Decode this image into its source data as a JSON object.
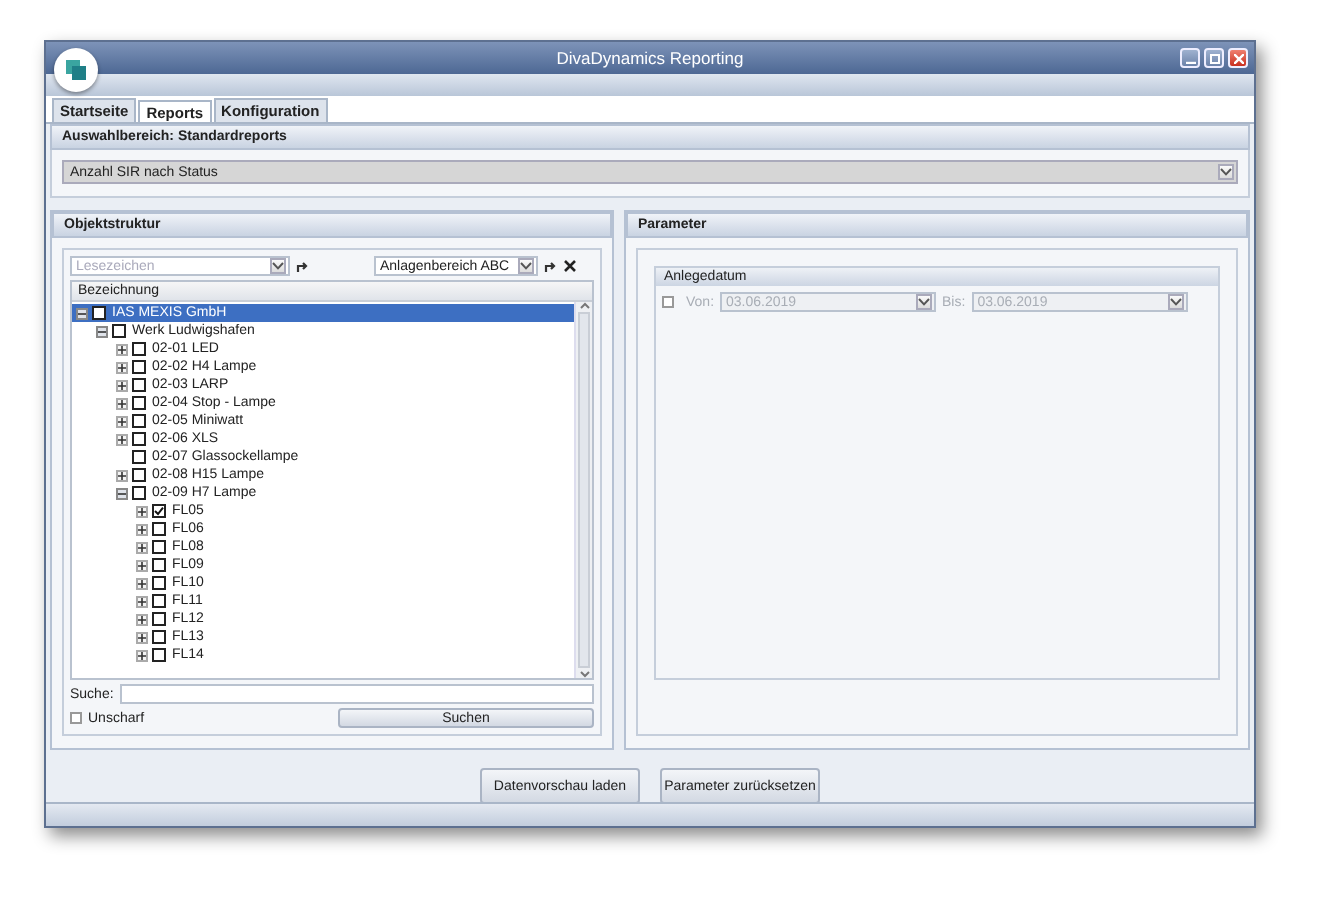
{
  "window": {
    "title": "DivaDynamics Reporting"
  },
  "tabs": [
    {
      "label": "Startseite",
      "selected": false
    },
    {
      "label": "Reports",
      "selected": true
    },
    {
      "label": "Konfiguration",
      "selected": false
    }
  ],
  "selection_area": {
    "title": "Auswahlbereich: Standardreports",
    "report": "Anzahl SIR nach Status"
  },
  "object_structure": {
    "title": "Objektstruktur",
    "bookmark_field": {
      "placeholder": "Lesezeichen"
    },
    "area_field": {
      "value": "Anlagenbereich ABC"
    },
    "tree": {
      "column": "Bezeichnung",
      "nodes": [
        {
          "label": "IAS MEXIS GmbH",
          "kind": "expanded",
          "checked": false,
          "selected": true,
          "children": [
            {
              "label": "Werk Ludwigshafen",
              "kind": "expanded",
              "checked": false,
              "selected": false,
              "children": [
                {
                  "label": "02-01 LED",
                  "kind": "collapsed",
                  "checked": false,
                  "selected": false
                },
                {
                  "label": "02-02 H4 Lampe",
                  "kind": "collapsed",
                  "checked": false,
                  "selected": false
                },
                {
                  "label": "02-03 LARP",
                  "kind": "collapsed",
                  "checked": false,
                  "selected": false
                },
                {
                  "label": "02-04 Stop - Lampe",
                  "kind": "collapsed",
                  "checked": false,
                  "selected": false
                },
                {
                  "label": "02-05 Miniwatt",
                  "kind": "collapsed",
                  "checked": false,
                  "selected": false
                },
                {
                  "label": "02-06 XLS",
                  "kind": "collapsed",
                  "checked": false,
                  "selected": false
                },
                {
                  "label": "02-07 Glassockellampe",
                  "kind": "leaf",
                  "checked": false,
                  "selected": false
                },
                {
                  "label": "02-08 H15 Lampe",
                  "kind": "collapsed",
                  "checked": false,
                  "selected": false
                },
                {
                  "label": "02-09 H7 Lampe",
                  "kind": "expanded",
                  "checked": false,
                  "selected": false,
                  "children": [
                    {
                      "label": "FL05",
                      "kind": "collapsed",
                      "checked": true,
                      "selected": false
                    },
                    {
                      "label": "FL06",
                      "kind": "collapsed",
                      "checked": false,
                      "selected": false
                    },
                    {
                      "label": "FL08",
                      "kind": "collapsed",
                      "checked": false,
                      "selected": false
                    },
                    {
                      "label": "FL09",
                      "kind": "collapsed",
                      "checked": false,
                      "selected": false
                    },
                    {
                      "label": "FL10",
                      "kind": "collapsed",
                      "checked": false,
                      "selected": false
                    },
                    {
                      "label": "FL11",
                      "kind": "collapsed",
                      "checked": false,
                      "selected": false
                    },
                    {
                      "label": "FL12",
                      "kind": "collapsed",
                      "checked": false,
                      "selected": false
                    },
                    {
                      "label": "FL13",
                      "kind": "collapsed",
                      "checked": false,
                      "selected": false
                    },
                    {
                      "label": "FL14",
                      "kind": "collapsed",
                      "checked": false,
                      "selected": false
                    }
                  ]
                }
              ]
            }
          ]
        }
      ]
    },
    "search": {
      "label": "Suche:",
      "fuzzy": {
        "label": "Unscharf",
        "checked": false
      },
      "button": "Suchen"
    }
  },
  "parameters": {
    "title": "Parameter",
    "group": {
      "title": "Anlegedatum",
      "enabled": {
        "checked": false
      },
      "from_label": "Von:",
      "from": "03.06.2019",
      "to_label": "Bis:",
      "to": "03.06.2019"
    }
  },
  "buttons": [
    "Datenvorschau laden",
    "Parameter zurücksetzen"
  ]
}
